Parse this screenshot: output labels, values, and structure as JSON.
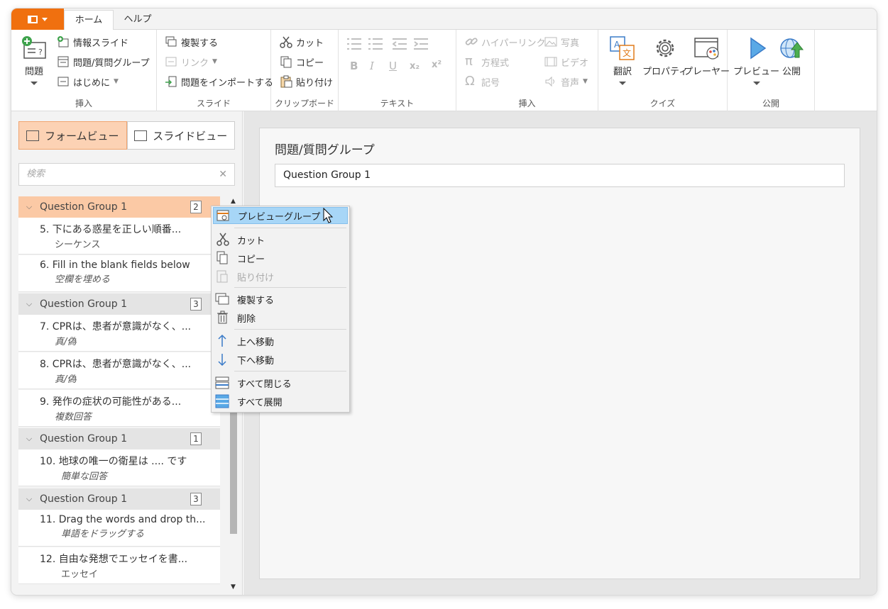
{
  "titlebar": {
    "tabs": [
      {
        "label": "ホーム"
      },
      {
        "label": "ヘルプ"
      }
    ]
  },
  "ribbon": {
    "insert": {
      "question_label": "問題",
      "info_slide": "情報スライド",
      "question_group": "問題/質問グループ",
      "intro": "はじめに",
      "group_label": "挿入"
    },
    "slide": {
      "duplicate": "複製する",
      "link": "リンク",
      "import": "問題をインポートする",
      "group_label": "スライド"
    },
    "clipboard": {
      "cut": "カット",
      "copy": "コピー",
      "paste": "貼り付け",
      "group_label": "クリップボード"
    },
    "text": {
      "group_label": "テキスト",
      "bold": "B",
      "italic": "I",
      "underline": "U",
      "subscript": "x₂",
      "superscript": "x²"
    },
    "insert2": {
      "hyperlink": "ハイパーリンク",
      "equation": "方程式",
      "symbol": "記号",
      "photo": "写真",
      "video": "ビデオ",
      "audio": "音声",
      "group_label": "挿入"
    },
    "quiz": {
      "translate": "翻訳",
      "properties": "プロパティ",
      "player": "プレーヤー",
      "group_label": "クイズ"
    },
    "publish": {
      "preview": "プレビュー",
      "publish": "公開",
      "group_label": "公開"
    }
  },
  "left": {
    "form_view": "フォームビュー",
    "slide_view": "スライドビュー",
    "search_placeholder": "検索",
    "groups": [
      {
        "name": "Question Group 1",
        "count": "2"
      },
      {
        "name": "Question Group 1",
        "count": "3"
      },
      {
        "name": "Question Group 1",
        "count": "1"
      },
      {
        "name": "Question Group 1",
        "count": "3"
      }
    ],
    "items": [
      {
        "title": "5.  下にある惑星を正しい順番...",
        "sub": "シーケンス"
      },
      {
        "title": "6.  Fill in the blank fields below",
        "sub": "空欄を埋める"
      },
      {
        "title": "7.  CPRは、患者が意識がなく、...",
        "sub": "真/偽"
      },
      {
        "title": "8.  CPRは、患者が意識がなく、...",
        "sub": "真/偽"
      },
      {
        "title": "9.  発作の症状の可能性がある...",
        "sub": "複数回答"
      },
      {
        "title": "10.  地球の唯一の衛星は .... です",
        "sub": "簡単な回答"
      },
      {
        "title": "11.  Drag the words and drop th...",
        "sub": "単語をドラッグする"
      },
      {
        "title": "12.  自由な発想でエッセイを書...",
        "sub": "エッセイ"
      }
    ]
  },
  "editor": {
    "label": "問題/質問グループ",
    "value": "Question Group 1"
  },
  "context_menu": {
    "preview_group": "プレビューグループ",
    "cut": "カット",
    "copy": "コピー",
    "paste": "貼り付け",
    "duplicate": "複製する",
    "delete": "削除",
    "move_up": "上へ移動",
    "move_down": "下へ移動",
    "collapse_all": "すべて閉じる",
    "expand_all": "すべて展開"
  },
  "colors": {
    "accent": "#f0700f",
    "selection": "#fbc9a5",
    "menu_highlight": "#a7d6f7"
  }
}
